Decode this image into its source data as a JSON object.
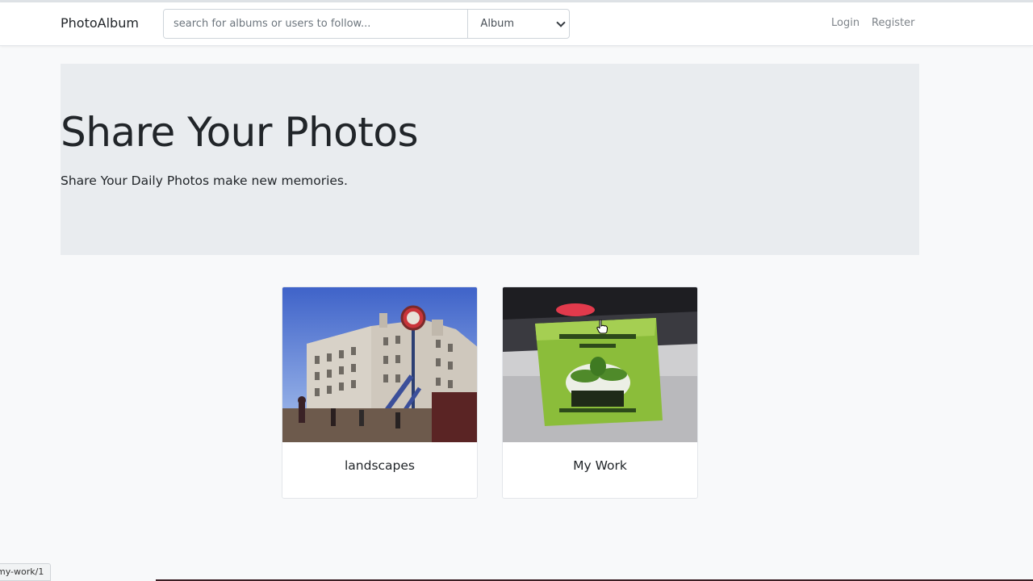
{
  "navbar": {
    "brand": "PhotoAlbum",
    "search": {
      "placeholder": "search for albums or users to follow...",
      "value": ""
    },
    "type_select": {
      "selected": "Album"
    },
    "links": {
      "login": "Login",
      "register": "Register"
    }
  },
  "hero": {
    "title": "Share Your Photos",
    "lead": "Share Your Daily Photos make new memories."
  },
  "albums": [
    {
      "title": "landscapes"
    },
    {
      "title": "My Work"
    }
  ],
  "status_bar": {
    "url_fragment": "my-work/1"
  },
  "colors": {
    "page_bg": "#f8f9fa",
    "hero_bg": "#e9ecef",
    "nav_link": "#7d8389"
  }
}
